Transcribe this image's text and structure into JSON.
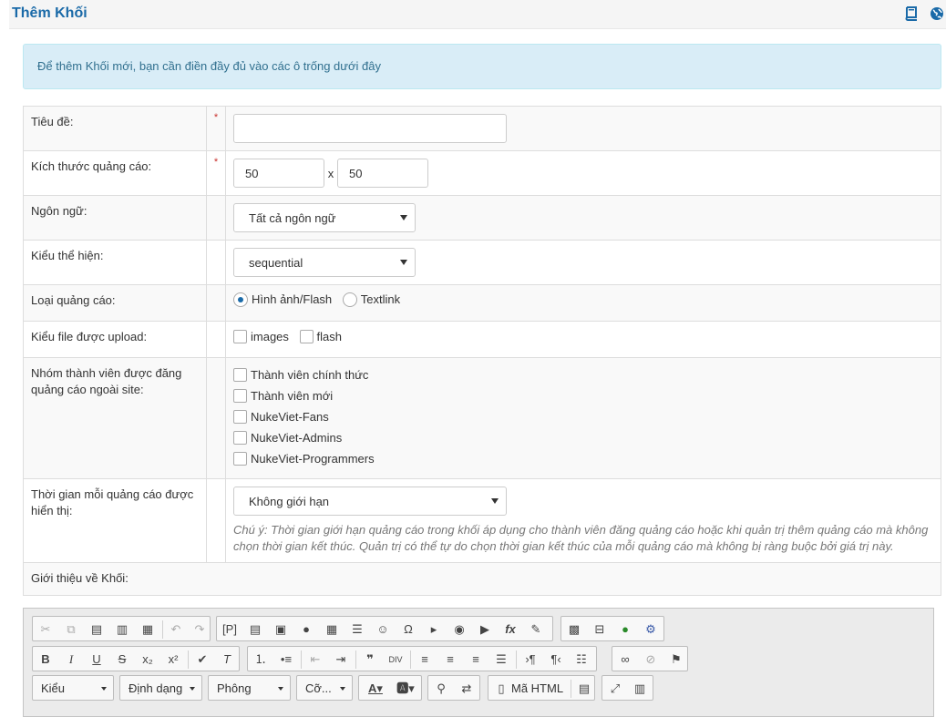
{
  "header": {
    "title": "Thêm Khối",
    "icons": [
      "book-icon",
      "globe-icon"
    ]
  },
  "alert": {
    "text": "Để thêm Khối mới, bạn cần điền đầy đủ vào các ô trống dưới đây"
  },
  "form": {
    "title": {
      "label": "Tiêu đề:",
      "required": "*",
      "value": ""
    },
    "size": {
      "label": "Kích thước quảng cáo:",
      "required": "*",
      "width": "50",
      "sep": "x",
      "height": "50"
    },
    "language": {
      "label": "Ngôn ngữ:",
      "selected": "Tất cả ngôn ngữ"
    },
    "display": {
      "label": "Kiểu thể hiện:",
      "selected": "sequential"
    },
    "ad_type": {
      "label": "Loại quảng cáo:",
      "options": [
        "Hình ảnh/Flash",
        "Textlink"
      ],
      "checked": "Hình ảnh/Flash"
    },
    "upload_types": {
      "label": "Kiểu file được upload:",
      "options": [
        "images",
        "flash"
      ]
    },
    "groups": {
      "label": "Nhóm thành viên được đăng quảng cáo ngoài site:",
      "options": [
        "Thành viên chính thức",
        "Thành viên mới",
        "NukeViet-Fans",
        "NukeViet-Admins",
        "NukeViet-Programmers"
      ]
    },
    "duration": {
      "label": "Thời gian mỗi quảng cáo được hiển thị:",
      "selected": "Không giới hạn",
      "note": "Chú ý: Thời gian giới hạn quảng cáo trong khối áp dụng cho thành viên đăng quảng cáo hoặc khi quản trị thêm quảng cáo mà không chọn thời gian kết thúc. Quản trị có thể tự do chọn thời gian kết thúc của mỗi quảng cáo mà không bị ràng buộc bởi giá trị này."
    },
    "intro": {
      "label": "Giới thiệu về Khối:"
    }
  },
  "editor": {
    "toolbar": {
      "row3": {
        "styles": "Kiểu",
        "format": "Định dạng",
        "font": "Phông",
        "size": "Cỡ...",
        "source": "Mã HTML"
      }
    }
  }
}
